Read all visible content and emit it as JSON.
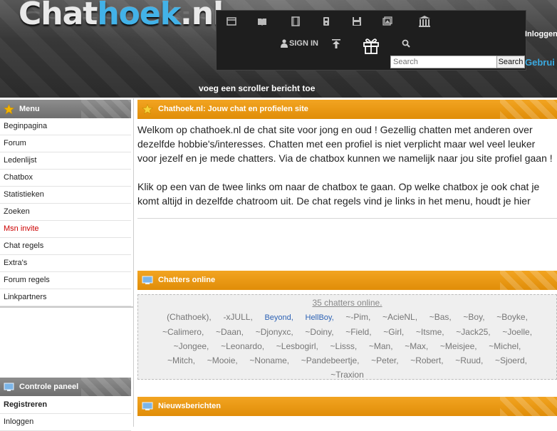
{
  "header": {
    "logo_part1": "Chat",
    "logo_part2": "hoek",
    "logo_part3": ".nl",
    "sign_in": "SIGN IN",
    "search_placeholder": "Search",
    "search_button": "Search",
    "login_link": "Inloggen (",
    "gebruik": "Gebrui",
    "scroller": "voeg een scroller bericht toe",
    "toolbar_icons": [
      "window-icon",
      "book-icon",
      "film-icon",
      "device-icon",
      "save-icon",
      "images-icon",
      "bank-icon"
    ]
  },
  "sidebar": {
    "menu_title": "Menu",
    "menu_items": [
      {
        "label": "Beginpagina"
      },
      {
        "label": "Forum"
      },
      {
        "label": "Ledenlijst"
      },
      {
        "label": "Chatbox"
      },
      {
        "label": "Statistieken"
      },
      {
        "label": "Zoeken"
      },
      {
        "label": "Msn invite",
        "color": "#cc0000"
      },
      {
        "label": "Chat regels"
      },
      {
        "label": "Extra's"
      },
      {
        "label": "Forum regels"
      },
      {
        "label": "Linkpartners"
      }
    ],
    "control_title": "Controle paneel",
    "control_items": [
      {
        "label": "Registreren"
      },
      {
        "label": "Inloggen"
      }
    ]
  },
  "main": {
    "welcome_title": "Chathoek.nl: Jouw chat en profielen site",
    "welcome_p1": "Welkom op chathoek.nl de chat site voor jong en oud ! Gezellig chatten met anderen over dezelfde hobbie's/interesses. Chatten met een profiel is niet verplicht maar wel veel leuker voor jezelf en je mede chatters. Via de chatbox kunnen we namelijk naar jou site profiel gaan !",
    "welcome_p2": "Klik op een van de twee links om naar de chatbox te gaan. Op welke chatbox je ook chat je komt altijd in dezelfde chatroom uit. De chat regels vind je links in het menu, houdt je hier",
    "online_title": "Chatters online",
    "online_count": "35 chatters online.",
    "chatters": [
      {
        "name": "(Chathoek),"
      },
      {
        "name": "-xJULL,"
      },
      {
        "name": "Beyond,",
        "blue": true
      },
      {
        "name": "HellBoy,",
        "blue": true
      },
      {
        "name": "~-Pim,"
      },
      {
        "name": "~AcieNL,"
      },
      {
        "name": "~Bas,"
      },
      {
        "name": "~Boy,"
      },
      {
        "name": "~Boyke,"
      },
      {
        "name": "~Calimero,"
      },
      {
        "name": "~Daan,"
      },
      {
        "name": "~Djonyxc,"
      },
      {
        "name": "~Doiny,"
      },
      {
        "name": "~Field,"
      },
      {
        "name": "~Girl,"
      },
      {
        "name": "~Itsme,"
      },
      {
        "name": "~Jack25,"
      },
      {
        "name": "~Joelle,"
      },
      {
        "name": "~Jongee,"
      },
      {
        "name": "~Leonardo,"
      },
      {
        "name": "~Lesbogirl,"
      },
      {
        "name": "~Lisss,"
      },
      {
        "name": "~Man,"
      },
      {
        "name": "~Max,"
      },
      {
        "name": "~Meisjee,"
      },
      {
        "name": "~Michel,"
      },
      {
        "name": "~Mitch,"
      },
      {
        "name": "~Mooie,"
      },
      {
        "name": "~Noname,"
      },
      {
        "name": "~Pandebeertje,"
      },
      {
        "name": "~Peter,"
      },
      {
        "name": "~Robert,"
      },
      {
        "name": "~Ruud,"
      },
      {
        "name": "~Sjoerd,"
      },
      {
        "name": "~Traxion"
      }
    ],
    "news_title": "Nieuwsberichten"
  },
  "colors": {
    "accent_orange": "#e8960f",
    "sidebar_gray": "#7d7d7d",
    "link_blue": "#2e63b5",
    "header_blue": "#3aa9e0"
  }
}
